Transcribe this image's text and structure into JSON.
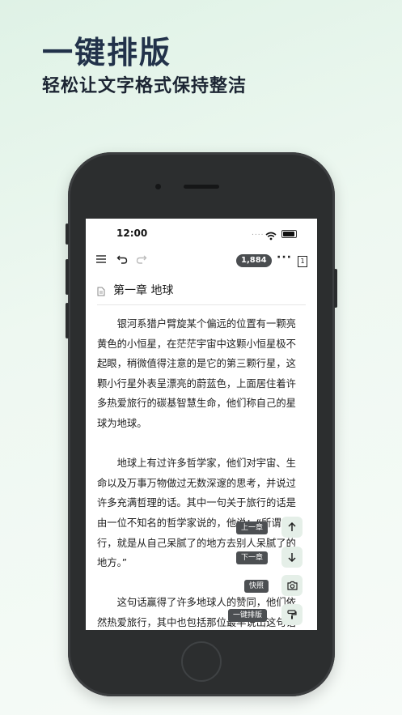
{
  "promo": {
    "headline": "一键排版",
    "subline": "轻松让文字格式保持整洁"
  },
  "status_bar": {
    "time": "12:00",
    "signal_dots": "....",
    "icons": [
      "wifi-icon",
      "battery-icon"
    ]
  },
  "toolbar": {
    "icons": [
      "menu-icon",
      "undo-icon",
      "redo-icon",
      "more-icon"
    ],
    "word_count": "1,884",
    "more_label": "···",
    "page_label": "1"
  },
  "chapter": {
    "icon": "document-icon",
    "title": "第一章 地球"
  },
  "content": {
    "paragraphs": [
      "银河系猎户臂旋某个偏远的位置有一颗亮黄色的小恒星，在茫茫宇宙中这颗小恒星极不起眼，稍微值得注意的是它的第三颗行星，这颗小行星外表呈漂亮的蔚蓝色，上面居住着许多热爱旅行的碳基智慧生命，他们称自己的星球为地球。",
      "地球上有过许多哲学家，他们对宇宙、生命以及万事万物做过无数深邃的思考，并说过许多充满哲理的话。其中一句关于旅行的话是由一位不知名的哲学家说的，他说：“所谓旅行，就是从自己呆腻了的地方去别人呆腻了的地方。”",
      "这句话赢得了许多地球人的赞同，他们依然热爱旅行，其中也包括那位最早说出这句话的哲学家。因为在一个地方呆腻"
    ]
  },
  "floating_actions": [
    {
      "icon": "arrow-up-icon",
      "tip": "上一章"
    },
    {
      "icon": "arrow-down-icon",
      "tip": "下一章"
    },
    {
      "icon": "camera-icon",
      "tip": "快照"
    },
    {
      "icon": "paint-roller-icon",
      "tip": "一键排版"
    }
  ],
  "colors": {
    "background_start": "#dff2e6",
    "headline": "#22324a",
    "phone_body": "#2c2e2f",
    "float_button_bg": "#e5efe8",
    "tooltip_bg": "#4c4f52"
  }
}
